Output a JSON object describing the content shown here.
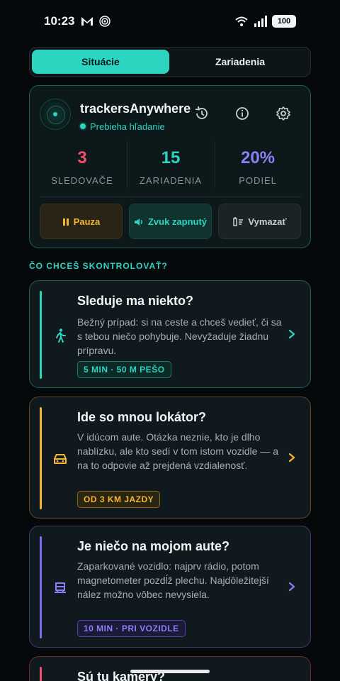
{
  "status_bar": {
    "time": "10:23",
    "battery": "100"
  },
  "tabs": [
    {
      "label": "Situácie",
      "active": true
    },
    {
      "label": "Zariadenia",
      "active": false
    }
  ],
  "scanner": {
    "app_name": "trackersAnywhere",
    "status": "Prebieha hľadanie",
    "stats": [
      {
        "value": "3",
        "label": "SLEDOVAČE",
        "color": "#f0506e"
      },
      {
        "value": "15",
        "label": "ZARIADENIA",
        "color": "#2dd4bf"
      },
      {
        "value": "20%",
        "label": "PODIEL",
        "color": "#8b7ff5"
      }
    ],
    "actions": {
      "pause": "Pauza",
      "sound": "Zvuk zapnutý",
      "clear": "Vymazať"
    }
  },
  "section_label": "ČO CHCEŠ SKONTROLOVAŤ?",
  "scenarios": [
    {
      "title": "Sleduje ma niekto?",
      "description": "Bežný prípad: si na ceste a chceš vedieť, či sa s tebou niečo pohybuje. Nevyžaduje žiadnu prípravu.",
      "chip": "5 MIN · 50 M PEŠO",
      "icon": "walking-person-icon",
      "accent": "#2dd4bf"
    },
    {
      "title": "Ide so mnou lokátor?",
      "description": "V idúcom aute. Otázka neznie, kto je dlho nablízku, ale kto sedí v tom istom vozidle — a na to odpovie až prejdená vzdialenosť.",
      "chip": "OD 3 KM JAZDY",
      "icon": "car-icon",
      "accent": "#f5b72f"
    },
    {
      "title": "Je niečo na mojom aute?",
      "description": "Zaparkované vozidlo: najprv rádio, potom magnetometer pozdĺž plechu. Najdôležitejší nález možno vôbec nevysiela.",
      "chip": "10 MIN · PRI VOZIDLE",
      "icon": "parked-car-icon",
      "accent": "#7c6cf0"
    },
    {
      "title": "Sú tu kamery?",
      "accent": "#f0506e"
    }
  ]
}
